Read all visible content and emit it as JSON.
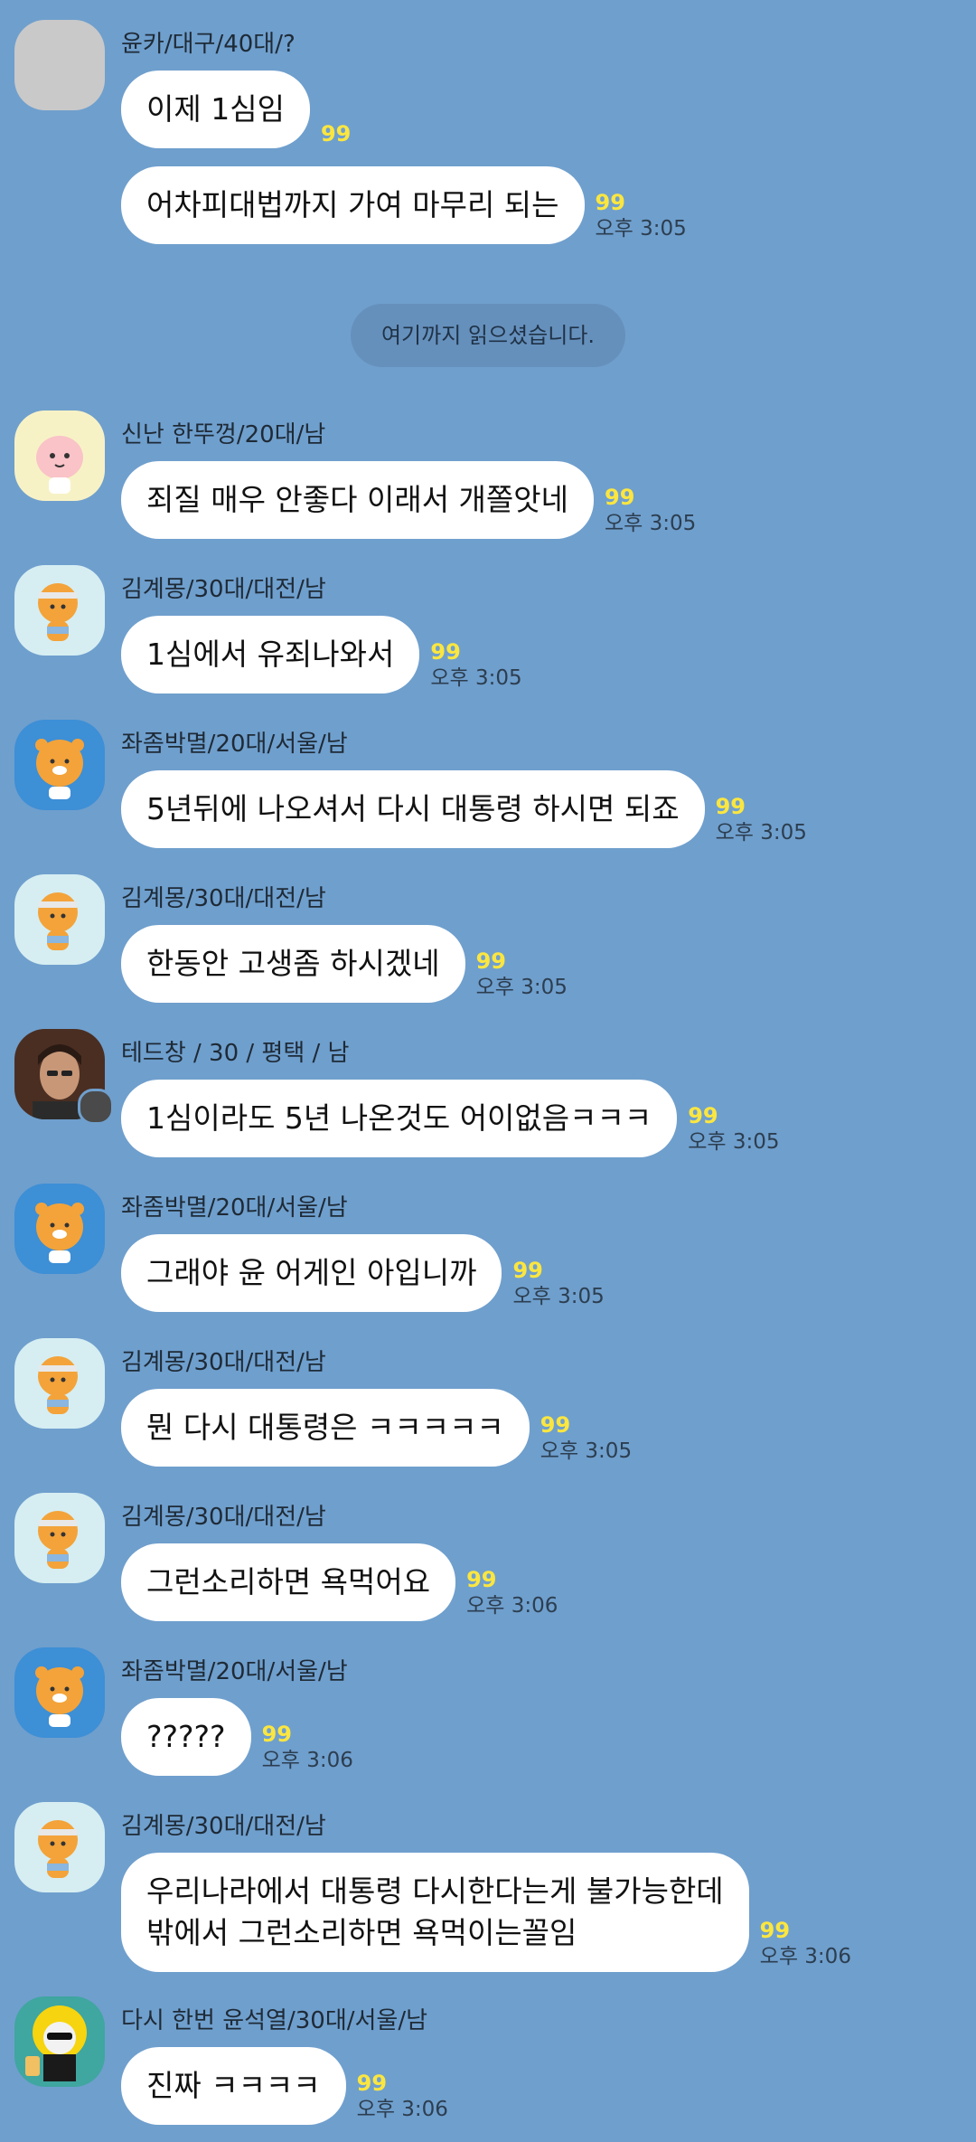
{
  "chat": {
    "read_divider": "여기까지 읽으셨습니다.",
    "messages": [
      {
        "sender": "윤카/대구/40대/?",
        "avatar": "blank-avatar-icon",
        "text": "이제 1심임",
        "unread": "99",
        "time": ""
      },
      {
        "sender": "",
        "avatar": "",
        "text": "어차피대법까지 가여 마무리 되는",
        "unread": "99",
        "time": "오후 3:05"
      },
      {
        "sender": "신난 한뚜껑/20대/남",
        "avatar": "apeach-avatar-icon",
        "text": "죄질 매우 안좋다 이래서 개쫄앗네",
        "unread": "99",
        "time": "오후 3:05"
      },
      {
        "sender": "김계몽/30대/대전/남",
        "avatar": "ryan-headband-avatar-icon",
        "text": "1심에서 유죄나와서",
        "unread": "99",
        "time": "오후 3:05"
      },
      {
        "sender": "좌좀박멸/20대/서울/남",
        "avatar": "ryan-avatar-icon",
        "text": "5년뒤에 나오셔서 다시 대통령 하시면 되죠",
        "unread": "99",
        "time": "오후 3:05"
      },
      {
        "sender": "김계몽/30대/대전/남",
        "avatar": "ryan-headband-avatar-icon",
        "text": "한동안 고생좀 하시겠네",
        "unread": "99",
        "time": "오후 3:05"
      },
      {
        "sender": "테드창 / 30 / 평택 / 남",
        "avatar": "photo-avatar-icon",
        "text": "1심이라도 5년 나온것도 어이없음ㅋㅋㅋ",
        "unread": "99",
        "time": "오후 3:05"
      },
      {
        "sender": "좌좀박멸/20대/서울/남",
        "avatar": "ryan-avatar-icon",
        "text": "그래야 윤 어게인 아입니까",
        "unread": "99",
        "time": "오후 3:05"
      },
      {
        "sender": "김계몽/30대/대전/남",
        "avatar": "ryan-headband-avatar-icon",
        "text": "뭔 다시 대통령은 ㅋㅋㅋㅋㅋ",
        "unread": "99",
        "time": "오후 3:05"
      },
      {
        "sender": "김계몽/30대/대전/남",
        "avatar": "ryan-headband-avatar-icon",
        "text": "그런소리하면 욕먹어요",
        "unread": "99",
        "time": "오후 3:06"
      },
      {
        "sender": "좌좀박멸/20대/서울/남",
        "avatar": "ryan-avatar-icon",
        "text": "?????",
        "unread": "99",
        "time": "오후 3:06"
      },
      {
        "sender": "김계몽/30대/대전/남",
        "avatar": "ryan-headband-avatar-icon",
        "text": "우리나라에서 대통령 다시한다는게 불가능한데\n밖에서 그런소리하면 욕먹이는꼴임",
        "unread": "99",
        "time": "오후 3:06"
      },
      {
        "sender": "다시 한번 윤석열/30대/서울/남",
        "avatar": "muzi-beer-avatar-icon",
        "text": "진짜 ㅋㅋㅋㅋ",
        "unread": "99",
        "time": "오후 3:06"
      }
    ]
  },
  "colors": {
    "background": "#6f9fcd",
    "bubble": "#ffffff",
    "unread": "#fbe640",
    "divider_bg": "#6690bc"
  }
}
